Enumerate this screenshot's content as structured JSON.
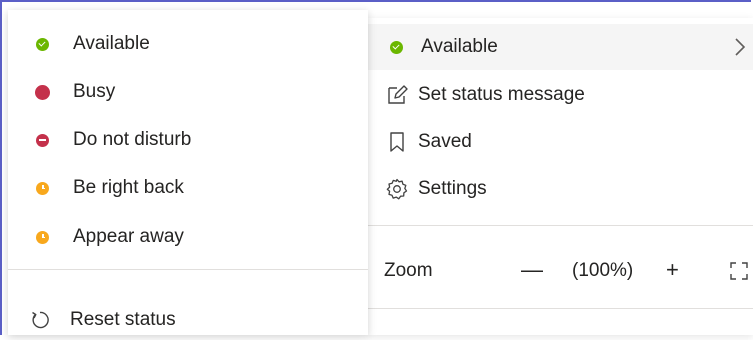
{
  "status_submenu": {
    "items": [
      {
        "label": "Available",
        "status": "available",
        "color": "#6bb700"
      },
      {
        "label": "Busy",
        "status": "busy",
        "color": "#c4314b"
      },
      {
        "label": "Do not disturb",
        "status": "dnd",
        "color": "#c4314b"
      },
      {
        "label": "Be right back",
        "status": "away",
        "color": "#f8a81d"
      },
      {
        "label": "Appear away",
        "status": "away",
        "color": "#f8a81d"
      }
    ],
    "reset_label": "Reset status",
    "reset_icon": "reset-icon"
  },
  "main_menu": {
    "status_label": "Available",
    "status_icon": "available-dot-icon",
    "set_status_label": "Set status message",
    "set_status_icon": "edit-icon",
    "saved_label": "Saved",
    "saved_icon": "bookmark-icon",
    "settings_label": "Settings",
    "settings_icon": "gear-icon",
    "zoom": {
      "label": "Zoom",
      "minus": "—",
      "value": "(100%)",
      "plus": "+"
    }
  },
  "colors": {
    "accent": "#5b5fc7",
    "available": "#6bb700",
    "busy": "#c4314b",
    "away": "#f8a81d"
  }
}
